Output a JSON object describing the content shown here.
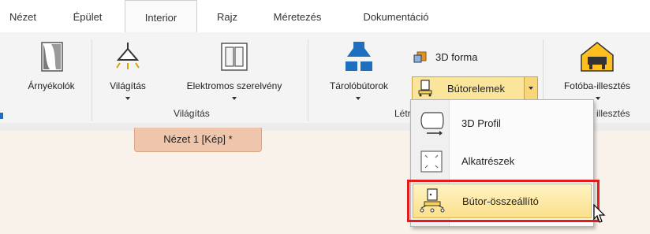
{
  "tabs": [
    {
      "label": "Nézet",
      "active": false
    },
    {
      "label": "Épület",
      "active": false
    },
    {
      "label": "Interior",
      "active": true
    },
    {
      "label": "Rajz",
      "active": false
    },
    {
      "label": "Méretezés",
      "active": false
    },
    {
      "label": "Dokumentáció",
      "active": false
    }
  ],
  "ribbon": {
    "arnyekolok": "Árnyékolók",
    "vilagitas": "Világítás",
    "elektromos": "Elektromos szerelvény",
    "vilagitas_group": "Világítás",
    "tarolobutorok": "Tárolóbútorok",
    "forma3d": "3D forma",
    "butorelemek": "Bútorelemek",
    "letre_group": "Létr",
    "fotoba": "Fotóba-illesztés",
    "illesztes_group": "illesztés"
  },
  "document_tab": "Nézet 1 [Kép] *",
  "dropdown": {
    "items": [
      {
        "label": "3D Profil",
        "icon": "3d-profile-icon"
      },
      {
        "label": "Alkatrészek",
        "icon": "parts-icon"
      },
      {
        "label": "Bútor-összeállító",
        "icon": "furniture-assembler-icon",
        "highlighted": true
      }
    ]
  },
  "colors": {
    "accent_tab": "#efc6ac",
    "highlight": "#fbe08c",
    "red_frame": "#e41b1b",
    "blue_icon": "#1e6fbf"
  }
}
